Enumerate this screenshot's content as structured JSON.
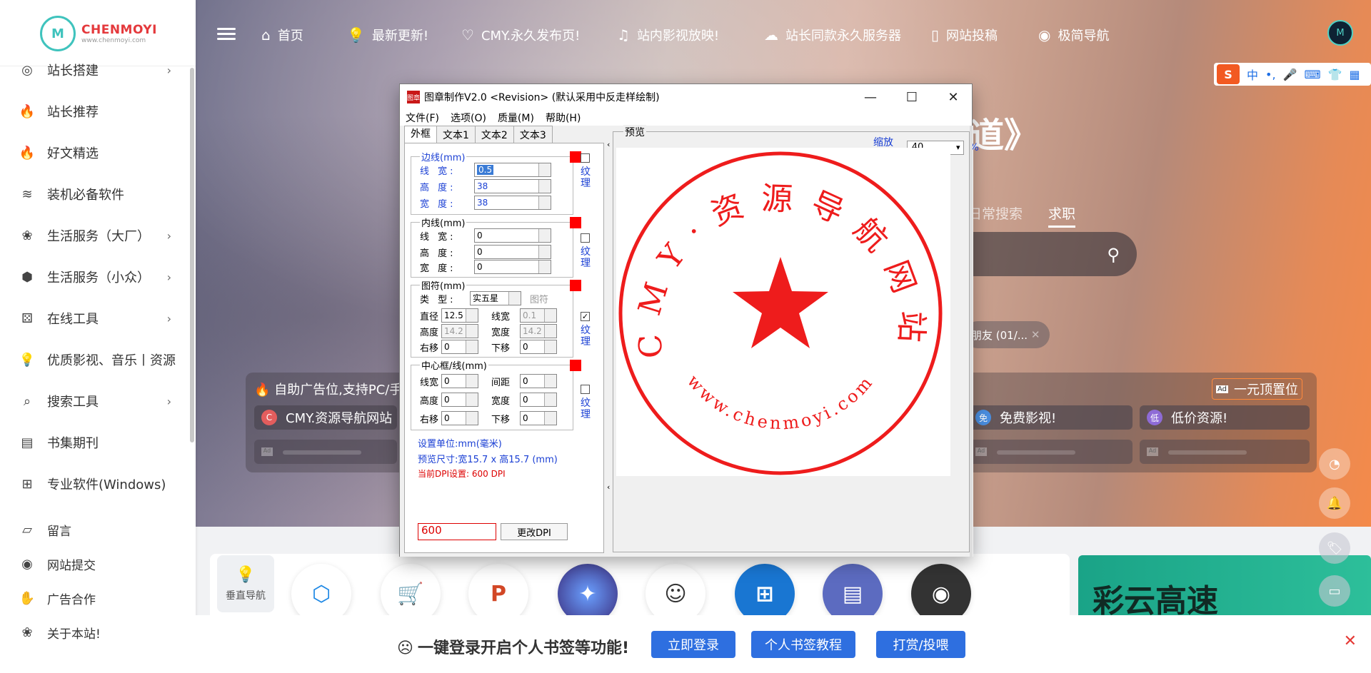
{
  "sidebar": {
    "logo_text": "CHENMOYI",
    "logo_url_text": "www.chenmoyi.com",
    "logo_mark": "M",
    "items": [
      {
        "label": "站长搭建",
        "icon": "target-icon",
        "arrow": true
      },
      {
        "label": "站长推荐",
        "icon": "fire-icon",
        "arrow": false
      },
      {
        "label": "好文精选",
        "icon": "fire-icon",
        "arrow": false
      },
      {
        "label": "装机必备软件",
        "icon": "layers-icon",
        "arrow": false
      },
      {
        "label": "生活服务（大厂）",
        "icon": "paw-icon",
        "arrow": true
      },
      {
        "label": "生活服务（小众）",
        "icon": "cube-icon",
        "arrow": true
      },
      {
        "label": "在线工具",
        "icon": "dice-icon",
        "arrow": true
      },
      {
        "label": "优质影视、音乐丨资源",
        "icon": "bulb-icon",
        "arrow": false
      },
      {
        "label": "搜索工具",
        "icon": "search-icon",
        "arrow": true
      },
      {
        "label": "书集期刊",
        "icon": "book-icon",
        "arrow": false
      },
      {
        "label": "专业软件(Windows)",
        "icon": "windows-icon",
        "arrow": false
      },
      {
        "label": "留言",
        "icon": "chart-icon",
        "arrow": false
      },
      {
        "label": "网站提交",
        "icon": "eye-icon",
        "arrow": false
      },
      {
        "label": "广告合作",
        "icon": "hand-icon",
        "arrow": false
      },
      {
        "label": "关于本站!",
        "icon": "paw-icon",
        "arrow": false
      }
    ]
  },
  "topnav": {
    "items": [
      {
        "label": "首页",
        "icon": "home-icon"
      },
      {
        "label": "最新更新!",
        "icon": "bulb-icon"
      },
      {
        "label": "CMY.永久发布页!",
        "icon": "heart-icon"
      },
      {
        "label": "站内影视放映!",
        "icon": "music-icon"
      },
      {
        "label": "站长同款永久服务器",
        "icon": "cloud-upload-icon"
      },
      {
        "label": "网站投稿",
        "icon": "document-icon"
      },
      {
        "label": "极简导航",
        "icon": "eye-icon"
      }
    ],
    "avatar_text": "M"
  },
  "ime_bar": {
    "logo": "S",
    "items": [
      "中",
      "•,",
      "🎤",
      "⌨",
      "👕",
      "▦"
    ]
  },
  "hero": {
    "title_fragment": "道》",
    "search_tabs": [
      "日常搜索",
      "求职"
    ],
    "history_chip": "朋友 (01/...",
    "ad_title": "自助广告位,支持PC/手机",
    "ad_button": "一元顶置位",
    "ad_cards": [
      {
        "label": "CMY.资源导航网站",
        "badge": "C",
        "color": "#e35d5d"
      },
      {
        "label": "免费影视!",
        "badge": "免",
        "color": "#4a8ee0"
      },
      {
        "label": "低价资源!",
        "badge": "低",
        "color": "#8e6bd6"
      }
    ],
    "ad_placeholder_tag": "Ad"
  },
  "apps": {
    "vertical_nav_label": "垂直导航",
    "banner_text": "彩云高速"
  },
  "bottom_bar": {
    "text": "一键登录开启个人书签等功能!",
    "buttons": [
      "立即登录",
      "个人书签教程",
      "打赏/投喂"
    ],
    "close": "✕"
  },
  "dialog": {
    "title": "图章制作V2.0 <Revision> (默认采用中反走样绘制)",
    "app_icon_text": "图章",
    "window_controls": [
      "—",
      "☐",
      "✕"
    ],
    "menu": [
      "文件(F)",
      "选项(O)",
      "质量(M)",
      "帮助(H)"
    ],
    "tabs": [
      "外框",
      "文本1",
      "文本2",
      "文本3"
    ],
    "border_group": {
      "title": "边线(mm)",
      "rows": [
        {
          "label": "线 宽:",
          "value": "0.5"
        },
        {
          "label": "高 度:",
          "value": "38"
        },
        {
          "label": "宽 度:",
          "value": "38"
        }
      ],
      "texture": "纹理",
      "texture_checked": false
    },
    "inner_group": {
      "title": "内线(mm)",
      "rows": [
        {
          "label": "线 宽:",
          "value": "0"
        },
        {
          "label": "高 度:",
          "value": "0"
        },
        {
          "label": "宽 度:",
          "value": "0"
        }
      ],
      "texture": "纹理",
      "texture_checked": false
    },
    "symbol_group": {
      "title": "图符(mm)",
      "type_label": "类 型:",
      "type_value": "实五星",
      "symbol_button": "图符",
      "rows": [
        {
          "l1": "直径",
          "v1": "12.5",
          "l2": "线宽",
          "v2": "0.1"
        },
        {
          "l1": "高度",
          "v1": "14.2",
          "l2": "宽度",
          "v2": "14.2"
        },
        {
          "l1": "右移",
          "v1": "0",
          "l2": "下移",
          "v2": "0"
        }
      ],
      "texture": "纹理",
      "texture_checked": true
    },
    "center_group": {
      "title": "中心框/线(mm)",
      "rows": [
        {
          "l1": "线宽",
          "v1": "0",
          "l2": "间距",
          "v2": "0"
        },
        {
          "l1": "高度",
          "v1": "0",
          "l2": "宽度",
          "v2": "0"
        },
        {
          "l1": "右移",
          "v1": "0",
          "l2": "下移",
          "v2": "0"
        }
      ],
      "texture": "纹理",
      "texture_checked": false
    },
    "unit_info": "设置单位:mm(毫米)",
    "preview_size": "预览尺寸:宽15.7 x 高15.7 (mm)",
    "dpi_info": "当前DPI设置: 600 DPI",
    "dpi_value": "600",
    "dpi_button": "更改DPI",
    "preview_title": "预览",
    "zoom_label": "缩放(Z)",
    "zoom_value": "40",
    "zoom_unit": "%",
    "stamp": {
      "top_text": "CMY·资源导航网站",
      "bottom_text": "www.chenmoyi.com",
      "color": "#ee1c1c"
    }
  }
}
